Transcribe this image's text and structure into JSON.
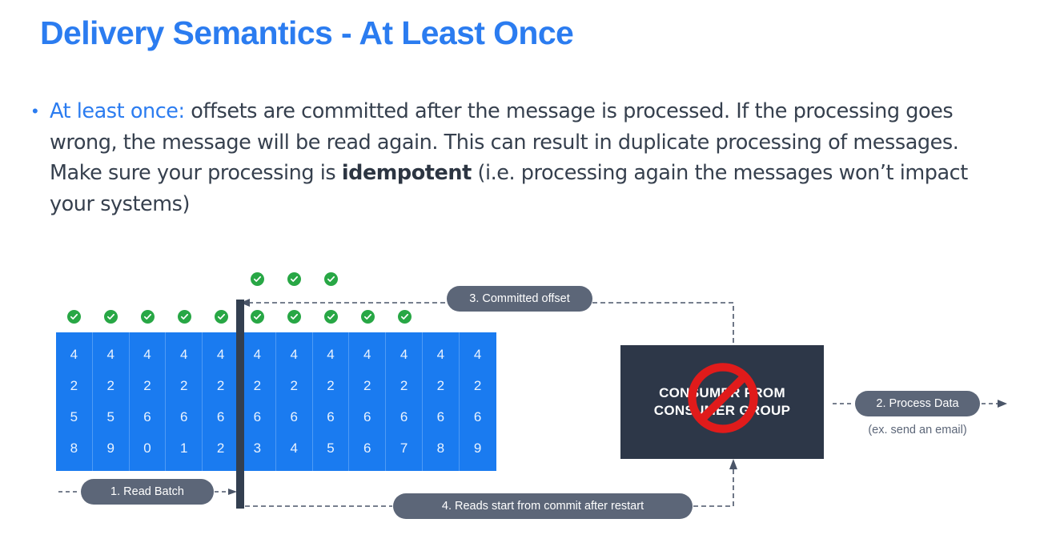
{
  "slide": {
    "title": "Delivery Semantics - At Least Once",
    "bullet": {
      "marker": "•",
      "lead_label": "At least once:",
      "text_part_1": " offsets are committed after the message is processed. If the processing goes wrong, the message will be read again. This can result in duplicate processing of messages. Make sure your processing is ",
      "emphasis": "idempotent",
      "text_part_2": " (i.e. processing again the messages won’t impact your systems)"
    }
  },
  "colors": {
    "accent_blue": "#2b7cf0",
    "partition_blue": "#1a7bf0",
    "pill_gray": "#5c6678",
    "consumer_dark": "#2d3748",
    "check_green": "#28a745",
    "no_sign_red": "#e01b1b",
    "body_text": "#36404e"
  },
  "diagram": {
    "partition": {
      "columns": [
        {
          "offset": "4258",
          "digits": [
            "4",
            "2",
            "5",
            "8"
          ],
          "committed_check": true,
          "reread_check": false
        },
        {
          "offset": "4259",
          "digits": [
            "4",
            "2",
            "5",
            "9"
          ],
          "committed_check": true,
          "reread_check": false
        },
        {
          "offset": "4260",
          "digits": [
            "4",
            "2",
            "6",
            "0"
          ],
          "committed_check": true,
          "reread_check": false
        },
        {
          "offset": "4261",
          "digits": [
            "4",
            "2",
            "6",
            "1"
          ],
          "committed_check": true,
          "reread_check": false
        },
        {
          "offset": "4262",
          "digits": [
            "4",
            "2",
            "6",
            "2"
          ],
          "committed_check": true,
          "reread_check": false
        },
        {
          "offset": "4263",
          "digits": [
            "4",
            "2",
            "6",
            "3"
          ],
          "committed_check": true,
          "reread_check": true
        },
        {
          "offset": "4264",
          "digits": [
            "4",
            "2",
            "6",
            "4"
          ],
          "committed_check": true,
          "reread_check": true
        },
        {
          "offset": "4265",
          "digits": [
            "4",
            "2",
            "6",
            "5"
          ],
          "committed_check": true,
          "reread_check": true
        },
        {
          "offset": "4266",
          "digits": [
            "4",
            "2",
            "6",
            "6"
          ],
          "committed_check": true,
          "reread_check": false
        },
        {
          "offset": "4267",
          "digits": [
            "4",
            "2",
            "6",
            "7"
          ],
          "committed_check": true,
          "reread_check": false
        },
        {
          "offset": "4268",
          "digits": [
            "4",
            "2",
            "6",
            "8"
          ],
          "committed_check": false,
          "reread_check": false
        },
        {
          "offset": "4269",
          "digits": [
            "4",
            "2",
            "6",
            "9"
          ],
          "committed_check": false,
          "reread_check": false
        }
      ]
    },
    "steps": {
      "read_batch": "1. Read Batch",
      "process_data": "2. Process Data",
      "process_data_note": "(ex. send an email)",
      "committed_offset": "3. Committed offset",
      "restart": "4. Reads start from commit after restart"
    },
    "consumer_box": {
      "line1": "CONSUMER FROM",
      "line2": "CONSUMER GROUP",
      "status": "crossed-out"
    }
  }
}
